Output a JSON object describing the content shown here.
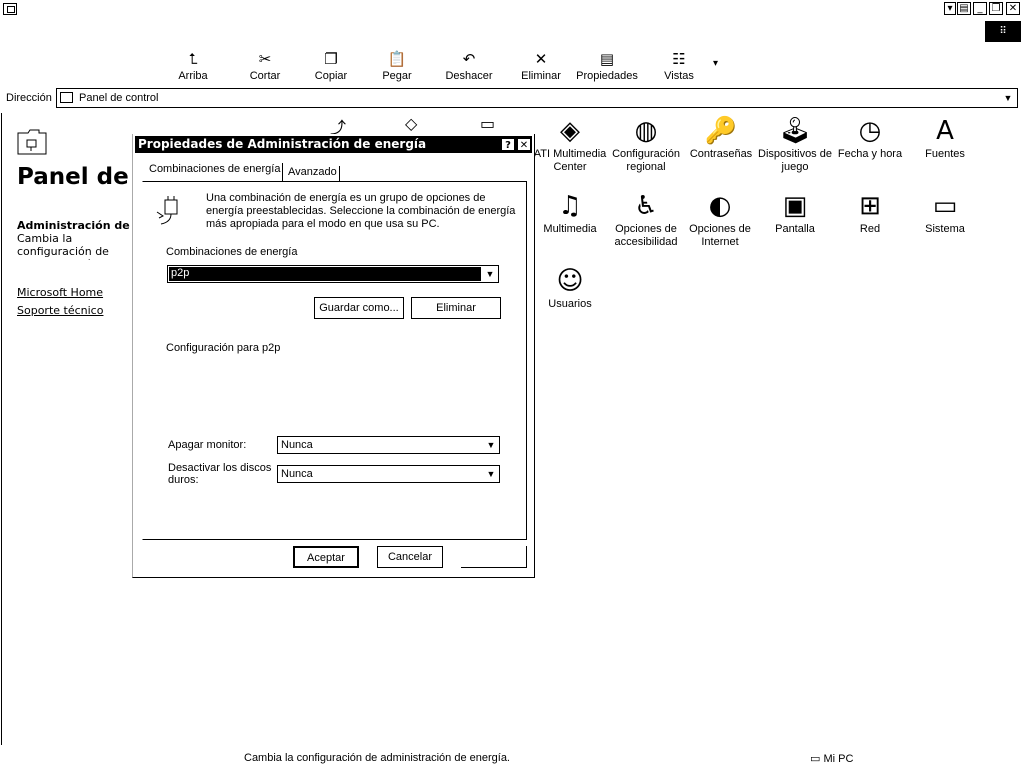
{
  "window": {
    "controls": [
      "▾",
      "▤",
      "_",
      "❐",
      "✕"
    ],
    "corner_glyph": "⠿"
  },
  "toolbar": [
    {
      "name": "up",
      "label": "Arriba",
      "glyph": "⮤"
    },
    {
      "name": "cut",
      "label": "Cortar",
      "glyph": "✂"
    },
    {
      "name": "copy",
      "label": "Copiar",
      "glyph": "❐"
    },
    {
      "name": "paste",
      "label": "Pegar",
      "glyph": "📋"
    },
    {
      "name": "undo",
      "label": "Deshacer",
      "glyph": "↶"
    },
    {
      "name": "delete",
      "label": "Eliminar",
      "glyph": "✕"
    },
    {
      "name": "properties",
      "label": "Propiedades",
      "glyph": "▤"
    },
    {
      "name": "views",
      "label": "Vistas",
      "glyph": "☷"
    }
  ],
  "views_dropdown": "▾",
  "address": {
    "label": "Dirección",
    "value": "Panel de control"
  },
  "left_panel": {
    "title": "Panel de control",
    "selected_title": "Administración de energía",
    "selected_desc": "Cambia la configuración de administración de energía.",
    "links": [
      "Microsoft Home",
      "Soporte técnico"
    ]
  },
  "icons": [
    {
      "name": "ati",
      "label1": "ATI Multimedia",
      "label2": "Center",
      "glyph": "◈"
    },
    {
      "name": "regional",
      "label1": "Configuración",
      "label2": "regional",
      "glyph": "◍"
    },
    {
      "name": "passwords",
      "label1": "Contraseñas",
      "label2": "",
      "glyph": "🔑"
    },
    {
      "name": "gamecontrollers",
      "label1": "Dispositivos de",
      "label2": "juego",
      "glyph": "🕹"
    },
    {
      "name": "datetime",
      "label1": "Fecha y hora",
      "label2": "",
      "glyph": "◷"
    },
    {
      "name": "fonts",
      "label1": "Fuentes",
      "label2": "",
      "glyph": "A"
    },
    {
      "name": "multimedia",
      "label1": "Multimedia",
      "label2": "",
      "glyph": "♫"
    },
    {
      "name": "accessibility",
      "label1": "Opciones de",
      "label2": "accesibilidad",
      "glyph": "♿"
    },
    {
      "name": "internet",
      "label1": "Opciones de",
      "label2": "Internet",
      "glyph": "◐"
    },
    {
      "name": "display",
      "label1": "Pantalla",
      "label2": "",
      "glyph": "▣"
    },
    {
      "name": "network",
      "label1": "Red",
      "label2": "",
      "glyph": "⊞"
    },
    {
      "name": "system",
      "label1": "Sistema",
      "label2": "",
      "glyph": "▭"
    },
    {
      "name": "users",
      "label1": "Usuarios",
      "label2": "",
      "glyph": "☺"
    }
  ],
  "dialog": {
    "title": "Propiedades de Administración de energía",
    "help": "?",
    "close": "✕",
    "tabs": [
      "Combinaciones de energía",
      "Avanzado"
    ],
    "description": "Una combinación de energía es un grupo de opciones de energía preestablecidas. Seleccione la combinación de energía más apropiada para el modo en que usa su PC.",
    "schemes_label": "Combinaciones de energía",
    "scheme_value": "p2p",
    "save_as": "Guardar como...",
    "delete": "Eliminar",
    "settings_for": "Configuración para p2p",
    "monitor_label": "Apagar monitor:",
    "monitor_value": "Nunca",
    "disks_label": "Desactivar los discos duros:",
    "disks_value": "Nunca",
    "ok": "Aceptar",
    "cancel": "Cancelar",
    "dd_glyph": "▼"
  },
  "status": {
    "text": "Cambia la configuración de administración de energía.",
    "zone": "Mi PC"
  }
}
